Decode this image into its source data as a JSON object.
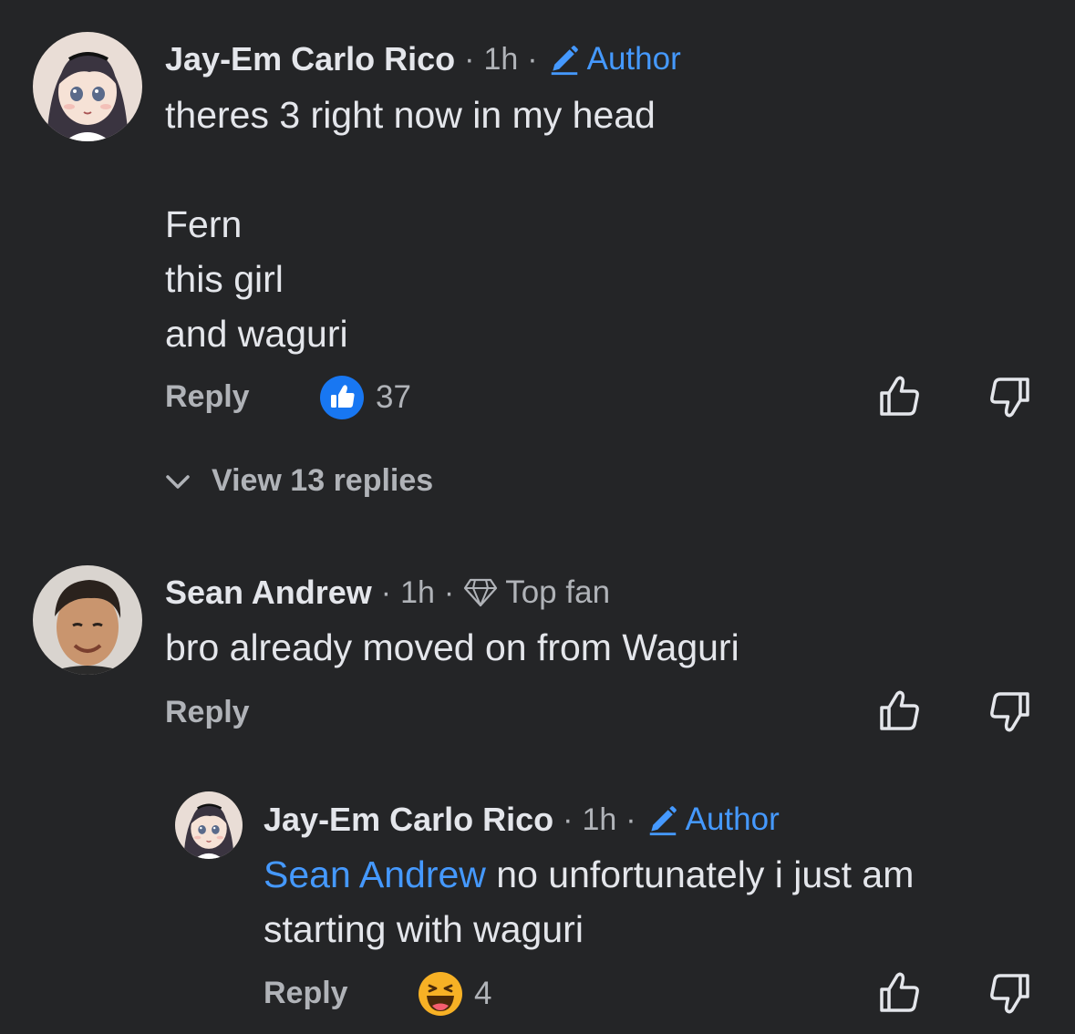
{
  "comments": [
    {
      "author": "Jay-Em Carlo Rico",
      "time": "1h",
      "badge": "Author",
      "text_lines": [
        "theres 3 right now in my head",
        "",
        "Fern",
        "this girl",
        "and waguri"
      ],
      "reply_label": "Reply",
      "reaction_icon": "like-reaction-icon",
      "reaction_count": "37",
      "view_replies": "View 13 replies"
    },
    {
      "author": "Sean Andrew",
      "time": "1h",
      "badge": "Top fan",
      "text": "bro already moved on from Waguri",
      "reply_label": "Reply"
    },
    {
      "author": "Jay-Em Carlo Rico",
      "time": "1h",
      "badge": "Author",
      "mention": "Sean Andrew",
      "text_after_mention": " no unfortunately i just am",
      "text_line2": "starting with waguri",
      "reply_label": "Reply",
      "reaction_icon": "haha-reaction-icon",
      "reaction_count": "4"
    }
  ],
  "colors": {
    "background": "#242527",
    "text": "#e4e6eb",
    "muted": "#b0b3b8",
    "accent": "#4599ff",
    "like_blue": "#1877f2"
  }
}
